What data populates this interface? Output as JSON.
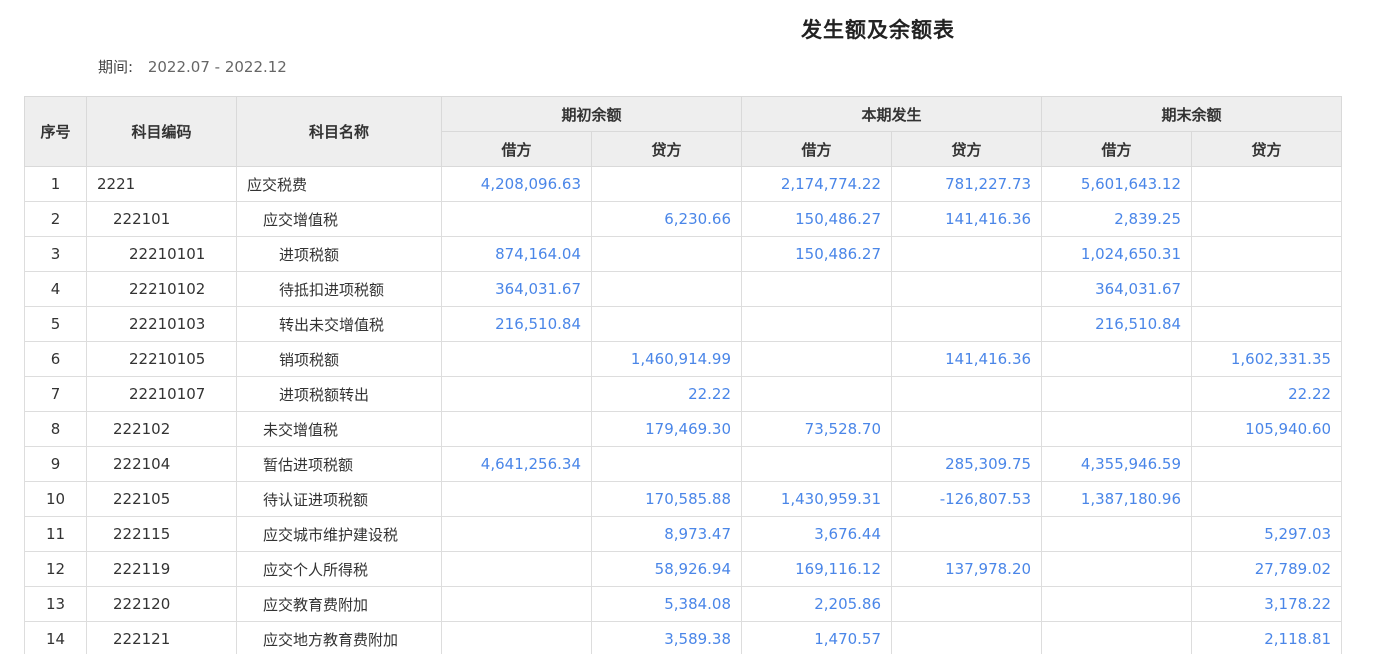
{
  "report": {
    "title": "发生额及余额表",
    "period_label": "期间:",
    "period_value": "2022.07 - 2022.12"
  },
  "table": {
    "headers": {
      "seq": "序号",
      "code": "科目编码",
      "name": "科目名称",
      "opening": "期初余额",
      "current": "本期发生",
      "closing": "期末余额",
      "debit": "借方",
      "credit": "贷方"
    },
    "rows": [
      {
        "seq": "1",
        "code": "2221",
        "name": "应交税费",
        "level": 1,
        "open_debit": "4,208,096.63",
        "open_credit": "",
        "cur_debit": "2,174,774.22",
        "cur_credit": "781,227.73",
        "close_debit": "5,601,643.12",
        "close_credit": ""
      },
      {
        "seq": "2",
        "code": "222101",
        "name": "应交增值税",
        "level": 2,
        "open_debit": "",
        "open_credit": "6,230.66",
        "cur_debit": "150,486.27",
        "cur_credit": "141,416.36",
        "close_debit": "2,839.25",
        "close_credit": ""
      },
      {
        "seq": "3",
        "code": "22210101",
        "name": "进项税额",
        "level": 3,
        "open_debit": "874,164.04",
        "open_credit": "",
        "cur_debit": "150,486.27",
        "cur_credit": "",
        "close_debit": "1,024,650.31",
        "close_credit": ""
      },
      {
        "seq": "4",
        "code": "22210102",
        "name": "待抵扣进项税额",
        "level": 3,
        "open_debit": "364,031.67",
        "open_credit": "",
        "cur_debit": "",
        "cur_credit": "",
        "close_debit": "364,031.67",
        "close_credit": ""
      },
      {
        "seq": "5",
        "code": "22210103",
        "name": "转出未交增值税",
        "level": 3,
        "open_debit": "216,510.84",
        "open_credit": "",
        "cur_debit": "",
        "cur_credit": "",
        "close_debit": "216,510.84",
        "close_credit": ""
      },
      {
        "seq": "6",
        "code": "22210105",
        "name": "销项税额",
        "level": 3,
        "open_debit": "",
        "open_credit": "1,460,914.99",
        "cur_debit": "",
        "cur_credit": "141,416.36",
        "close_debit": "",
        "close_credit": "1,602,331.35"
      },
      {
        "seq": "7",
        "code": "22210107",
        "name": "进项税额转出",
        "level": 3,
        "open_debit": "",
        "open_credit": "22.22",
        "cur_debit": "",
        "cur_credit": "",
        "close_debit": "",
        "close_credit": "22.22"
      },
      {
        "seq": "8",
        "code": "222102",
        "name": "未交增值税",
        "level": 2,
        "open_debit": "",
        "open_credit": "179,469.30",
        "cur_debit": "73,528.70",
        "cur_credit": "",
        "close_debit": "",
        "close_credit": "105,940.60"
      },
      {
        "seq": "9",
        "code": "222104",
        "name": "暂估进项税额",
        "level": 2,
        "open_debit": "4,641,256.34",
        "open_credit": "",
        "cur_debit": "",
        "cur_credit": "285,309.75",
        "close_debit": "4,355,946.59",
        "close_credit": ""
      },
      {
        "seq": "10",
        "code": "222105",
        "name": "待认证进项税额",
        "level": 2,
        "open_debit": "",
        "open_credit": "170,585.88",
        "cur_debit": "1,430,959.31",
        "cur_credit": "-126,807.53",
        "close_debit": "1,387,180.96",
        "close_credit": ""
      },
      {
        "seq": "11",
        "code": "222115",
        "name": "应交城市维护建设税",
        "level": 2,
        "open_debit": "",
        "open_credit": "8,973.47",
        "cur_debit": "3,676.44",
        "cur_credit": "",
        "close_debit": "",
        "close_credit": "5,297.03"
      },
      {
        "seq": "12",
        "code": "222119",
        "name": "应交个人所得税",
        "level": 2,
        "open_debit": "",
        "open_credit": "58,926.94",
        "cur_debit": "169,116.12",
        "cur_credit": "137,978.20",
        "close_debit": "",
        "close_credit": "27,789.02"
      },
      {
        "seq": "13",
        "code": "222120",
        "name": "应交教育费附加",
        "level": 2,
        "open_debit": "",
        "open_credit": "5,384.08",
        "cur_debit": "2,205.86",
        "cur_credit": "",
        "close_debit": "",
        "close_credit": "3,178.22"
      },
      {
        "seq": "14",
        "code": "222121",
        "name": "应交地方教育费附加",
        "level": 2,
        "open_debit": "",
        "open_credit": "3,589.38",
        "cur_debit": "1,470.57",
        "cur_credit": "",
        "close_debit": "",
        "close_credit": "2,118.81"
      }
    ]
  },
  "colors": {
    "amount_text": "#4a86e8",
    "header_bg": "#eeeeee",
    "border": "#dddddd"
  }
}
